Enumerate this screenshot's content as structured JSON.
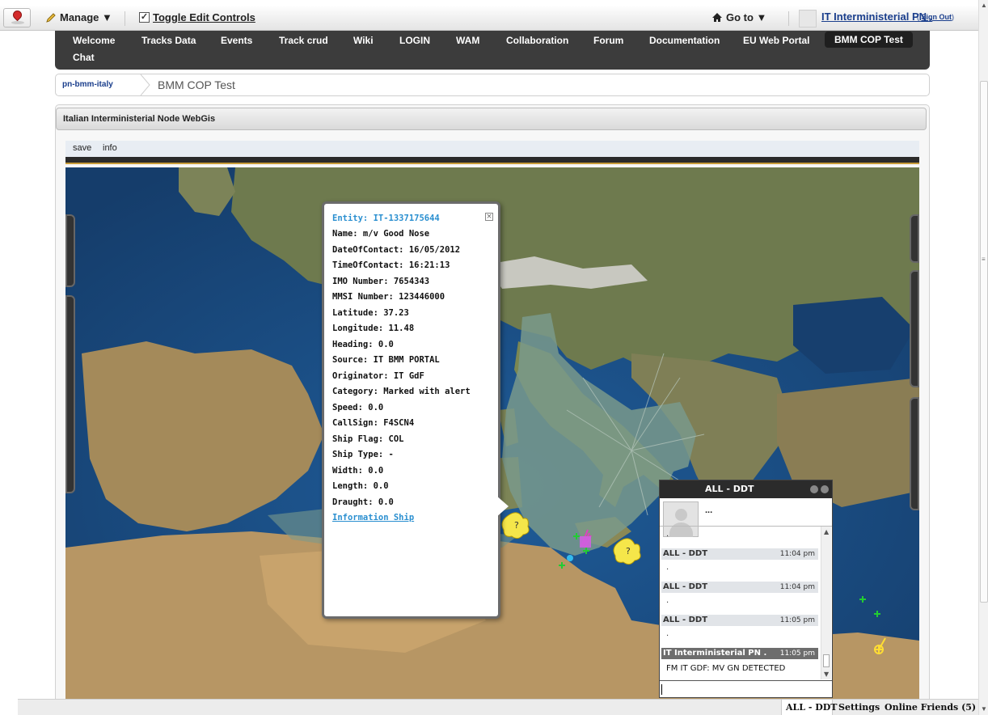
{
  "dockbar": {
    "manage_label": "Manage ▼",
    "toggle_label": "Toggle Edit Controls",
    "goto_label": "Go to ▼",
    "user_name": "IT Interministerial PN .",
    "signout_prefix": "( ",
    "signout_label": "Sign Out",
    "signout_suffix": ")"
  },
  "nav": {
    "items": [
      "Welcome",
      "Tracks Data",
      "Events",
      "Track crud",
      "Wiki",
      "LOGIN",
      "WAM",
      "Collaboration",
      "Forum",
      "Documentation",
      "EU Web Portal",
      "BMM COP Test",
      "Chat"
    ],
    "active": "BMM COP Test"
  },
  "breadcrumb": {
    "site": "pn-bmm-italy",
    "page": "BMM COP Test"
  },
  "portlet": {
    "title": "Italian Interministerial Node WebGis",
    "toolbar": [
      "save",
      "info"
    ]
  },
  "popup": {
    "entity": "Entity: IT-1337175644",
    "close_glyph": "×",
    "fields": [
      "Name: m/v Good Nose",
      "DateOfContact: 16/05/2012",
      "TimeOfContact: 16:21:13",
      "IMO Number: 7654343",
      "MMSI Number: 123446000",
      "Latitude: 37.23",
      "Longitude: 11.48",
      "Heading: 0.0",
      "Source: IT BMM PORTAL",
      "Originator: IT GdF",
      "Category: Marked with alert",
      "Speed: 0.0",
      "CallSign: F4SCN4",
      "Ship Flag: COL",
      "Ship Type: -",
      "Width: 0.0",
      "Length: 0.0",
      "Draught: 0.0"
    ],
    "link": "Information Ship"
  },
  "chat": {
    "title": "ALL - DDT",
    "status": "...",
    "messages": [
      {
        "dot": ".",
        "name": "ALL - DDT",
        "time": "11:04 pm"
      },
      {
        "dot": ".",
        "name": "ALL - DDT",
        "time": "11:04 pm"
      },
      {
        "dot": ".",
        "name": "ALL - DDT",
        "time": "11:05 pm"
      },
      {
        "dot": ".",
        "name": "IT Interministerial PN .",
        "time": "11:05 pm",
        "text": "FM IT GDF: MV GN DETECTED"
      }
    ]
  },
  "bottombar": {
    "chat_tab": "ALL - DDT",
    "settings": "Settings",
    "online": "Online Friends (5)"
  },
  "colors": {
    "nav_bg": "#3c3c3c",
    "link_blue": "#2a8fd0",
    "sea": "#1e4f86",
    "land": "#8a7a55",
    "track_overlay": "#7a9a8c"
  },
  "icons": {
    "logo": "map-pin-icon",
    "manage": "pencil-icon",
    "toggle": "checkbox-icon",
    "goto": "home-icon",
    "alert": "question-marker-icon",
    "track": "cross-marker-icon"
  }
}
